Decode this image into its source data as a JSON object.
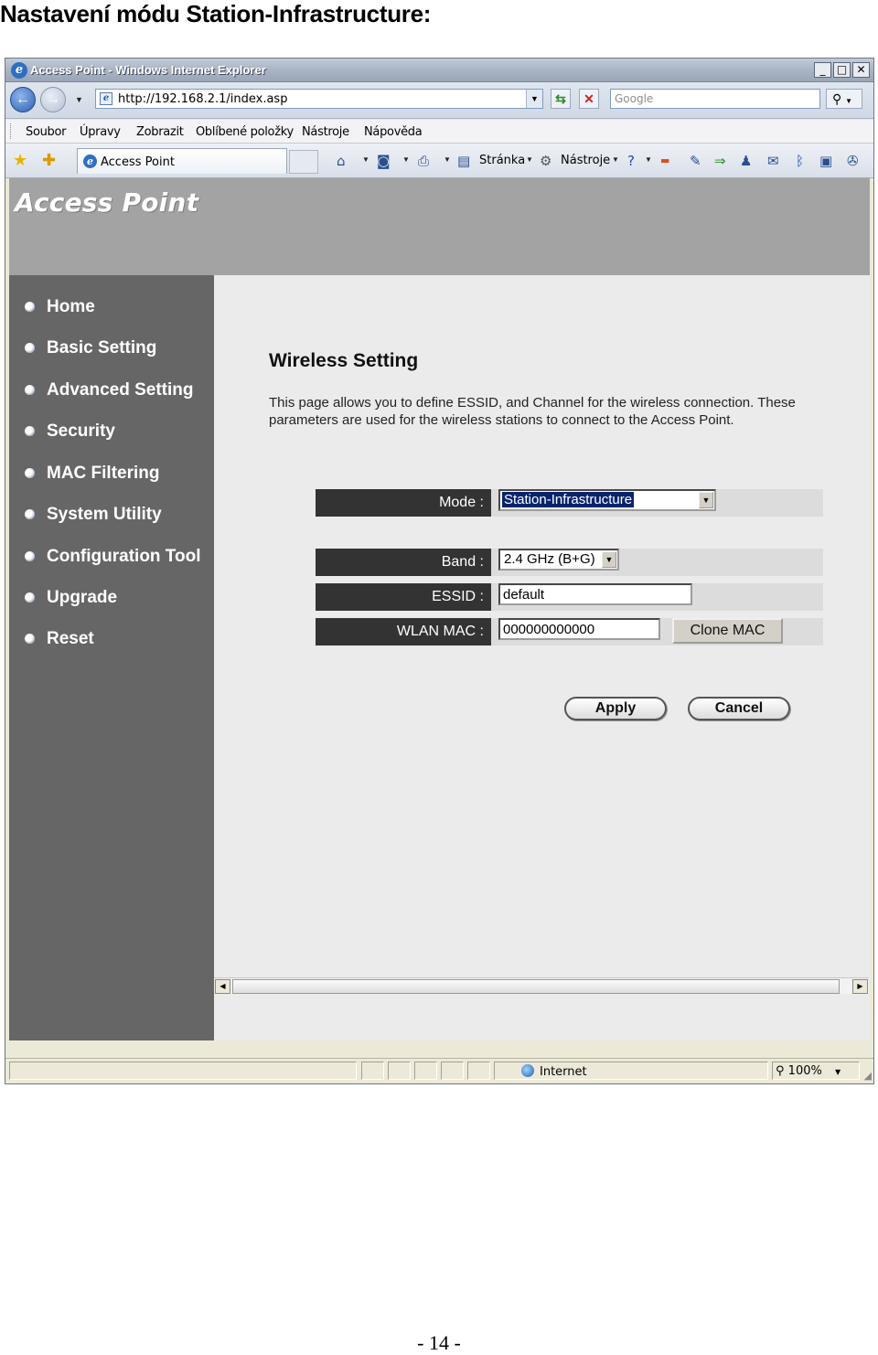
{
  "doc": {
    "heading": "Nastavení módu Station-Infrastructure:",
    "page_number": "- 14 -"
  },
  "browser": {
    "window_title": "Access Point - Windows Internet Explorer",
    "url": "http://192.168.2.1/index.asp",
    "search_placeholder": "Google",
    "menu": [
      "Soubor",
      "Úpravy",
      "Zobrazit",
      "Oblíbené položky",
      "Nástroje",
      "Nápověda"
    ],
    "tab_label": "Access Point",
    "command_bar": {
      "page_label": "Stránka",
      "tools_label": "Nástroje"
    },
    "status": {
      "zone": "Internet",
      "zoom": "100%"
    },
    "icons": [
      "back-icon",
      "forward-icon",
      "refresh-icon",
      "stop-icon",
      "search-icon",
      "favorites-star-icon",
      "add-favorites-icon",
      "home-icon",
      "feeds-icon",
      "print-icon",
      "help-icon",
      "globe-icon",
      "zoom-icon"
    ]
  },
  "app": {
    "logo": "Access Point",
    "sidebar": [
      {
        "label": "Home"
      },
      {
        "label": "Basic Setting"
      },
      {
        "label": "Advanced Setting"
      },
      {
        "label": "Security"
      },
      {
        "label": "MAC Filtering"
      },
      {
        "label": "System Utility"
      },
      {
        "label": "Configuration Tool"
      },
      {
        "label": "Upgrade"
      },
      {
        "label": "Reset"
      }
    ],
    "page_title": "Wireless Setting",
    "description": "This page allows you to define ESSID, and Channel for the wireless connection. These parameters are used for the wireless stations to connect to the Access Point.",
    "form": {
      "mode_label": "Mode :",
      "mode_value": "Station-Infrastructure",
      "band_label": "Band :",
      "band_value": "2.4 GHz (B+G)",
      "essid_label": "ESSID :",
      "essid_value": "default",
      "wlan_mac_label": "WLAN MAC :",
      "wlan_mac_value": "000000000000",
      "clone_mac_label": "Clone MAC"
    },
    "buttons": {
      "apply": "Apply",
      "cancel": "Cancel"
    }
  }
}
